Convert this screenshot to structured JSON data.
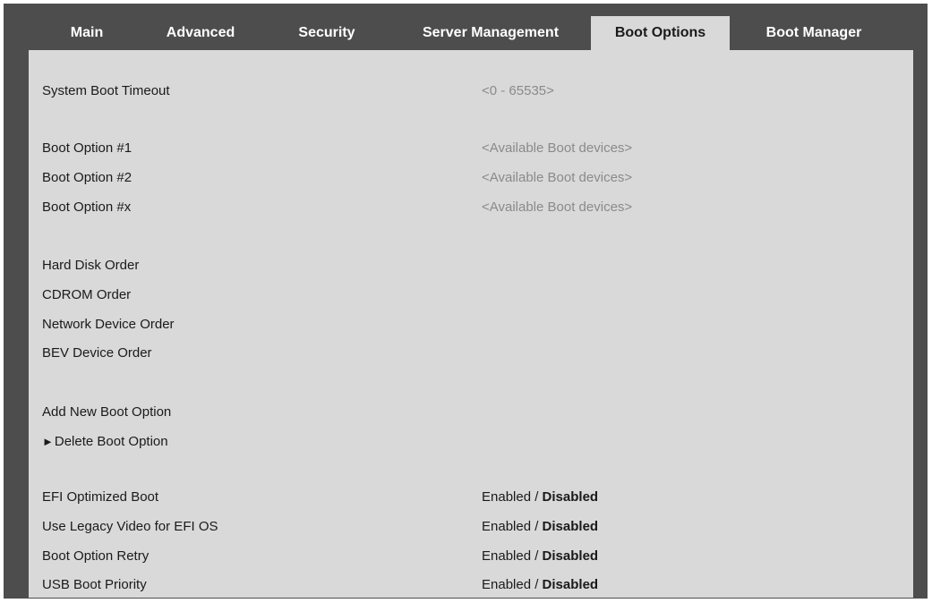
{
  "tabs": [
    {
      "label": "Main"
    },
    {
      "label": "Advanced"
    },
    {
      "label": "Security"
    },
    {
      "label": "Server Management"
    },
    {
      "label": "Boot Options",
      "active": true
    },
    {
      "label": "Boot Manager"
    }
  ],
  "items": {
    "system_boot_timeout": {
      "label": "System Boot Timeout",
      "value": "<0 - 65535>"
    },
    "boot_option_1": {
      "label": "Boot Option #1",
      "value": "<Available Boot devices>"
    },
    "boot_option_2": {
      "label": "Boot Option #2",
      "value": "<Available Boot devices>"
    },
    "boot_option_x": {
      "label": "Boot Option #x",
      "value": "<Available Boot devices>"
    },
    "hard_disk_order": {
      "label": "Hard Disk Order"
    },
    "cdrom_order": {
      "label": "CDROM Order"
    },
    "network_device_order": {
      "label": "Network Device Order"
    },
    "bev_device_order": {
      "label": "BEV Device Order"
    },
    "add_new_boot_option": {
      "label": "Add New Boot Option"
    },
    "delete_boot_option": {
      "label": "Delete Boot Option",
      "arrow": "►"
    },
    "efi_optimized_boot": {
      "label": "EFI Optimized Boot",
      "value_a": "Enabled /",
      "value_b": " Disabled"
    },
    "legacy_video": {
      "label": "Use Legacy Video for EFI OS",
      "value_a": "Enabled /",
      "value_b": " Disabled"
    },
    "boot_option_retry": {
      "label": "Boot Option Retry",
      "value_a": "Enabled /",
      "value_b": " Disabled"
    },
    "usb_boot_priority": {
      "label": "USB Boot Priority",
      "value_a": "Enabled /",
      "value_b": " Disabled"
    }
  },
  "colors": {
    "frame": "#4d4d4d",
    "panel": "#d9d9d9",
    "hint_text": "#8a8a8a",
    "text": "#1a1a1a"
  }
}
